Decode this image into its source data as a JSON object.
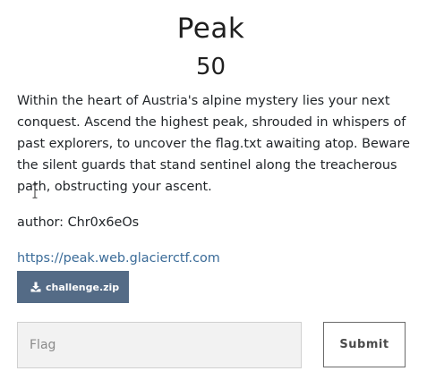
{
  "challenge": {
    "name": "Peak",
    "points": "50",
    "description": "Within the heart of Austria's alpine mystery lies your next conquest. Ascend the highest peak, shrouded in whispers of past explorers, to uncover the flag.txt awaiting atop. Beware the silent guards that stand sentinel along the treacherous path, obstructing your ascent.",
    "author": "author: Chr0x6eOs",
    "url": "https://peak.web.glacierctf.com",
    "file_label": "challenge.zip",
    "file_icon": "download-icon"
  },
  "form": {
    "flag_placeholder": "Flag",
    "flag_value": "",
    "submit_label": "Submit"
  },
  "colors": {
    "file_button": "#546b86",
    "link": "#3a6b98",
    "input_background": "#f2f2f2"
  }
}
